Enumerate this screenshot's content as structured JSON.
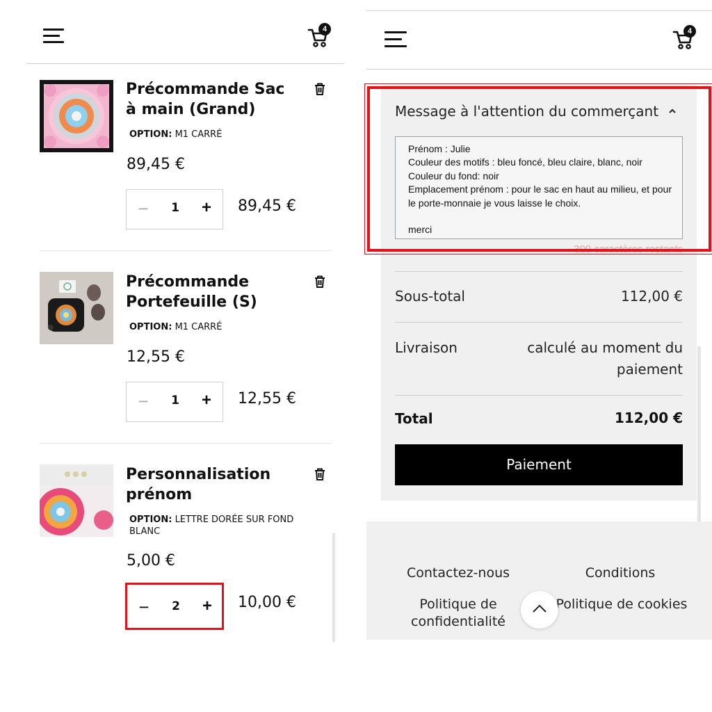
{
  "left_panel": {
    "cart_count": "4",
    "items": [
      {
        "title": "Précommande Sac à main (Grand)",
        "option_label": "OPTION:",
        "option_value": "M1 CARRÉ",
        "unit_price": "89,45 €",
        "quantity": "1",
        "line_total": "89,45 €"
      },
      {
        "title": "Précommande Portefeuille (S)",
        "option_label": "OPTION:",
        "option_value": "M1 CARRÉ",
        "unit_price": "12,55 €",
        "quantity": "1",
        "line_total": "12,55 €"
      },
      {
        "title": "Personnalisation prénom",
        "option_label": "OPTION:",
        "option_value": "LETTRE DORÉE SUR FOND BLANC",
        "unit_price": "5,00 €",
        "quantity": "2",
        "line_total": "10,00 €"
      }
    ]
  },
  "right_panel": {
    "cart_count": "4",
    "message": {
      "heading": "Message à l'attention du commerçant",
      "text": "Prénom : Julie\nCouleur des motifs : bleu foncé, bleu claire, blanc, noir\nCouleur du fond: noir\nEmplacement prénom : pour le sac en haut au milieu, et pour le porte-monnaie je vous laisse le choix.\n\nmerci",
      "counter": "300 caractères restants"
    },
    "subtotal_label": "Sous-total",
    "subtotal_value": "112,00 €",
    "shipping_label": "Livraison",
    "shipping_value_line1": "calculé au moment du",
    "shipping_value_line2": "paiement",
    "total_label": "Total",
    "total_value": "112,00 €",
    "pay_button": "Paiement",
    "footer": {
      "contact": "Contactez-nous",
      "conditions": "Conditions",
      "privacy_line1": "Politique de",
      "privacy_line2": "confidentialité",
      "cookies": "Politique de cookies"
    }
  },
  "colors": {
    "accent_red": "#e0121a",
    "button_black": "#000000",
    "summary_bg": "#f0f0f0"
  },
  "icons": [
    "menu-icon",
    "cart-icon",
    "trash-icon",
    "chevron-up-icon",
    "scroll-top-icon"
  ]
}
